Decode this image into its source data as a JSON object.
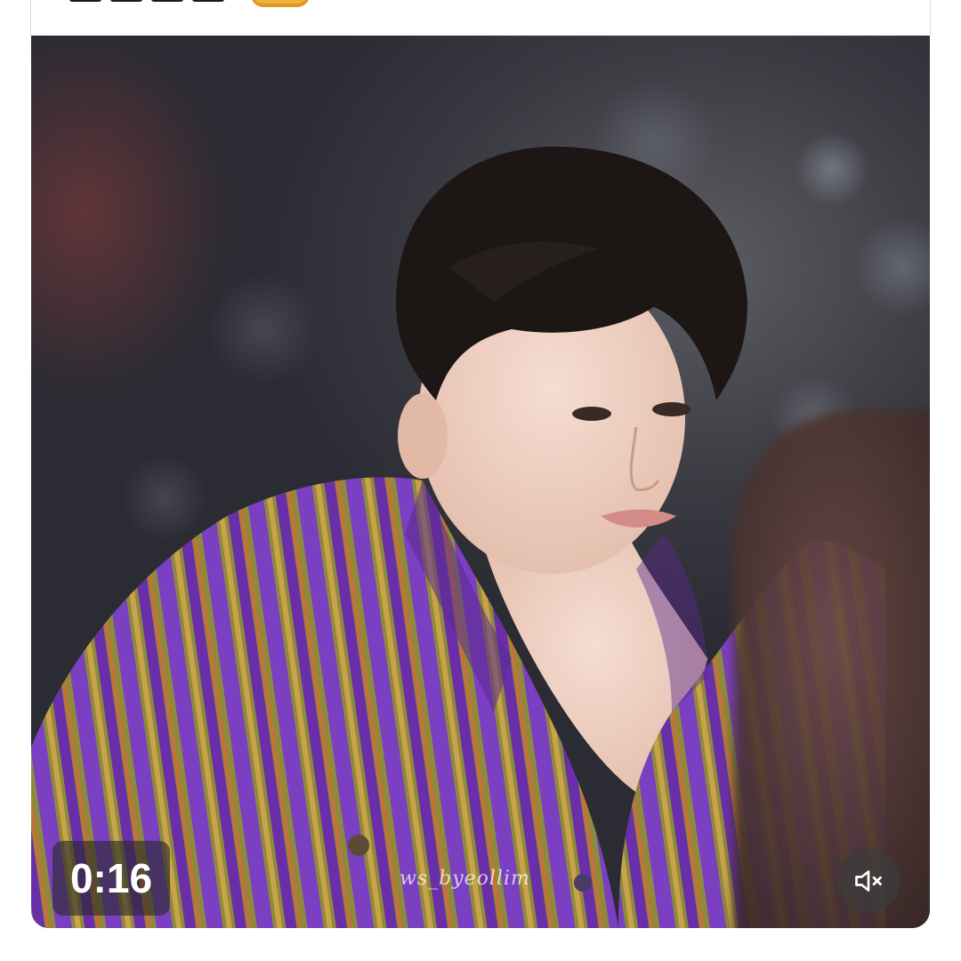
{
  "post": {
    "top_text_fragment": "",
    "emoji_fragment": "emoji-face-partial"
  },
  "video": {
    "elapsed_time": "0:16",
    "watermark": "ws_byeollim",
    "mute_icon": "speaker-muted-icon",
    "muted": true,
    "colors": {
      "badge_bg": "#2828289e",
      "shirt_purple": "#7a3cb8",
      "shirt_olive": "#8a8a3a"
    }
  }
}
